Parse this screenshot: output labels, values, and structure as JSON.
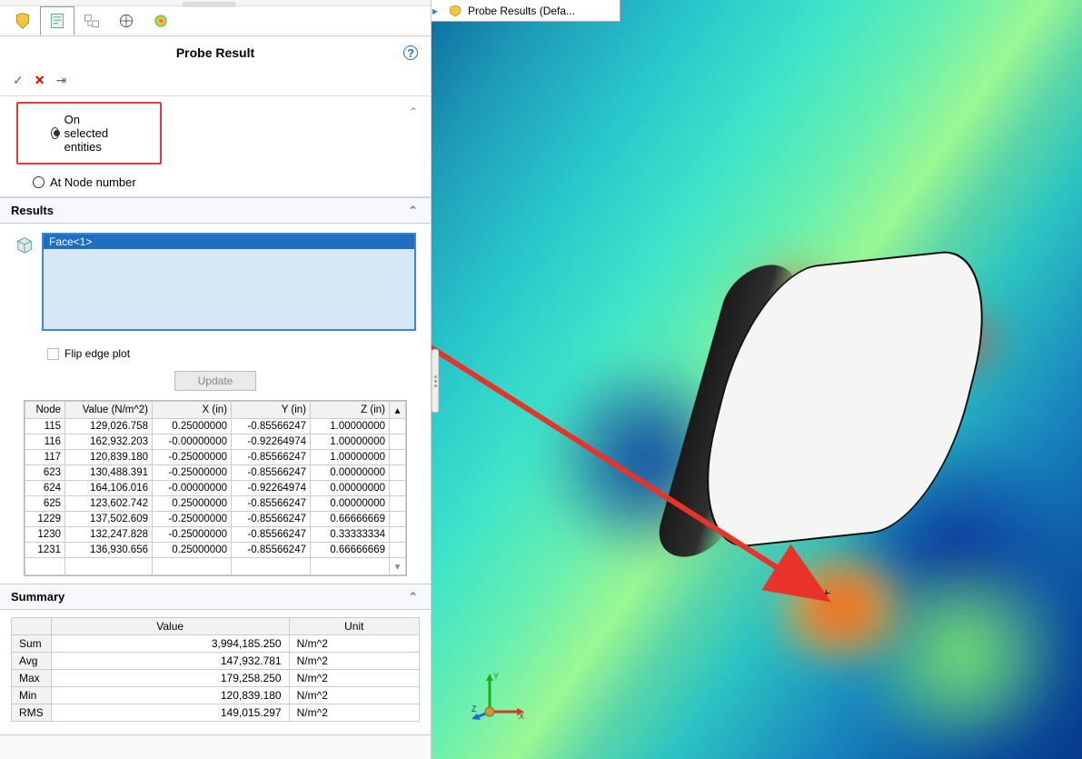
{
  "panel": {
    "title": "Probe Result",
    "help": "?"
  },
  "actions": {
    "ok": "✓",
    "cancel": "✕",
    "pin": "⇥"
  },
  "options": {
    "on_selected": "On selected entities",
    "at_node": "At Node number"
  },
  "results": {
    "header": "Results",
    "face_item": "Face<1>",
    "flip_label": "Flip edge plot",
    "update_btn": "Update"
  },
  "columns": {
    "node": "Node",
    "value": "Value (N/m^2)",
    "x": "X (in)",
    "y": "Y (in)",
    "z": "Z (in)"
  },
  "rows": [
    {
      "node": "115",
      "value": "129,026.758",
      "x": "0.25000000",
      "y": "-0.85566247",
      "z": "1.00000000"
    },
    {
      "node": "116",
      "value": "162,932.203",
      "x": "-0.00000000",
      "y": "-0.92264974",
      "z": "1.00000000"
    },
    {
      "node": "117",
      "value": "120,839.180",
      "x": "-0.25000000",
      "y": "-0.85566247",
      "z": "1.00000000"
    },
    {
      "node": "623",
      "value": "130,488.391",
      "x": "-0.25000000",
      "y": "-0.85566247",
      "z": "0.00000000"
    },
    {
      "node": "624",
      "value": "164,106.016",
      "x": "-0.00000000",
      "y": "-0.92264974",
      "z": "0.00000000"
    },
    {
      "node": "625",
      "value": "123,602.742",
      "x": "0.25000000",
      "y": "-0.85566247",
      "z": "0.00000000"
    },
    {
      "node": "1229",
      "value": "137,502.609",
      "x": "-0.25000000",
      "y": "-0.85566247",
      "z": "0.66666669"
    },
    {
      "node": "1230",
      "value": "132,247.828",
      "x": "-0.25000000",
      "y": "-0.85566247",
      "z": "0.33333334"
    },
    {
      "node": "1231",
      "value": "136,930.656",
      "x": "0.25000000",
      "y": "-0.85566247",
      "z": "0.66666669"
    }
  ],
  "summary": {
    "header": "Summary",
    "col_value": "Value",
    "col_unit": "Unit",
    "rows": [
      {
        "label": "Sum",
        "value": "3,994,185.250",
        "unit": "N/m^2"
      },
      {
        "label": "Avg",
        "value": "147,932.781",
        "unit": "N/m^2"
      },
      {
        "label": "Max",
        "value": "179,258.250",
        "unit": "N/m^2"
      },
      {
        "label": "Min",
        "value": "120,839.180",
        "unit": "N/m^2"
      },
      {
        "label": "RMS",
        "value": "149,015.297",
        "unit": "N/m^2"
      }
    ]
  },
  "viewport": {
    "tab_title": "Probe Results  (Defa...",
    "tab_arrow": "▸",
    "triad": {
      "x": "X",
      "y": "Y",
      "z": "Z"
    }
  }
}
